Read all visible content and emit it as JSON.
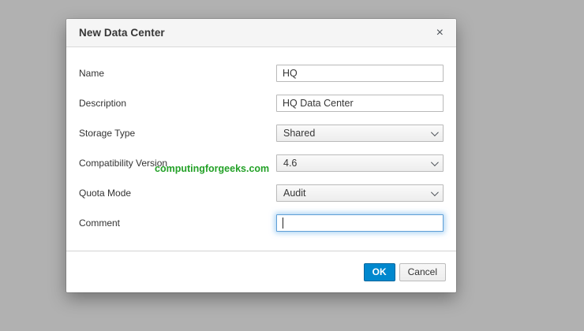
{
  "page": {
    "background_color": "#b1b1b1"
  },
  "watermark": {
    "text": "computingforgeeks.com",
    "color": "#23a127"
  },
  "dialog": {
    "title": "New Data Center",
    "close_icon": "×",
    "fields": [
      {
        "label": "Name",
        "type": "text",
        "value": "HQ"
      },
      {
        "label": "Description",
        "type": "text",
        "value": "HQ Data Center"
      },
      {
        "label": "Storage Type",
        "type": "select",
        "value": "Shared"
      },
      {
        "label": "Compatibility Version",
        "type": "select",
        "value": "4.6"
      },
      {
        "label": "Quota Mode",
        "type": "select",
        "value": "Audit"
      },
      {
        "label": "Comment",
        "type": "text",
        "value": "",
        "focused": true
      }
    ],
    "footer": {
      "ok_label": "OK",
      "cancel_label": "Cancel"
    },
    "colors": {
      "primary_button": "#0088ce",
      "primary_button_border": "#00659c",
      "focus_ring": "#66afe9"
    }
  }
}
